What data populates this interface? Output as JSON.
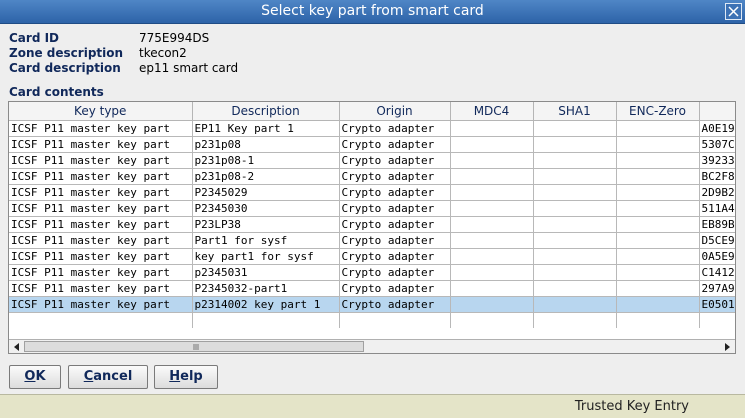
{
  "window": {
    "title": "Select key part from smart card"
  },
  "info": {
    "card_id_label": "Card ID",
    "card_id_value": "775E994DS",
    "zone_label": "Zone description",
    "zone_value": "tkecon2",
    "card_desc_label": "Card description",
    "card_desc_value": "ep11 smart card"
  },
  "section": {
    "card_contents_label": "Card contents"
  },
  "table": {
    "columns": [
      "Key type",
      "Description",
      "Origin",
      "MDC4",
      "SHA1",
      "ENC-Zero",
      ""
    ],
    "rows": [
      [
        "ICSF P11 master key part",
        "EP11 Key part 1",
        "Crypto adapter",
        "",
        "",
        "",
        "A0E19"
      ],
      [
        "ICSF P11 master key part",
        "p231p08",
        "Crypto adapter",
        "",
        "",
        "",
        "5307C"
      ],
      [
        "ICSF P11 master key part",
        "p231p08-1",
        "Crypto adapter",
        "",
        "",
        "",
        "39233"
      ],
      [
        "ICSF P11 master key part",
        "p231p08-2",
        "Crypto adapter",
        "",
        "",
        "",
        "BC2F8"
      ],
      [
        "ICSF P11 master key part",
        "P2345029",
        "Crypto adapter",
        "",
        "",
        "",
        "2D9B2"
      ],
      [
        "ICSF P11 master key part",
        "P2345030",
        "Crypto adapter",
        "",
        "",
        "",
        "511A4"
      ],
      [
        "ICSF P11 master key part",
        "P23LP38",
        "Crypto adapter",
        "",
        "",
        "",
        "EB89B"
      ],
      [
        "ICSF P11 master key part",
        "Part1 for sysf",
        "Crypto adapter",
        "",
        "",
        "",
        "D5CE9"
      ],
      [
        "ICSF P11 master key part",
        "key part1 for sysf",
        "Crypto adapter",
        "",
        "",
        "",
        "0A5E9"
      ],
      [
        "ICSF P11 master key part",
        "p2345031",
        "Crypto adapter",
        "",
        "",
        "",
        "C1412"
      ],
      [
        "ICSF P11 master key part",
        "P2345032-part1",
        "Crypto adapter",
        "",
        "",
        "",
        "297A9"
      ],
      [
        "ICSF P11 master key part",
        "p2314002 key part 1",
        "Crypto adapter",
        "",
        "",
        "",
        "E0501"
      ]
    ],
    "selected_row": 11
  },
  "buttons": {
    "ok_mnemonic": "O",
    "ok_rest": "K",
    "cancel_mnemonic": "C",
    "cancel_rest": "ancel",
    "help_mnemonic": "H",
    "help_rest": "elp"
  },
  "status": {
    "text": "Trusted Key Entry"
  },
  "colors": {
    "title_bar": "#2d63a8",
    "selection": "#b8d6ef",
    "status_bar": "#e4e4c8"
  }
}
